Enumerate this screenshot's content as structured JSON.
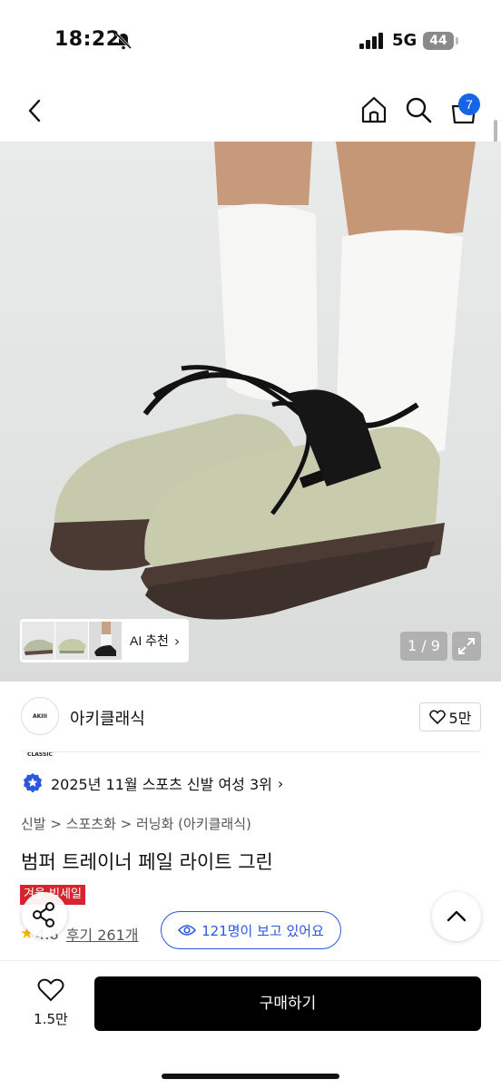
{
  "status_bar": {
    "time": "18:22",
    "network": "5G",
    "battery": "44"
  },
  "nav": {
    "cart_count": "7"
  },
  "gallery": {
    "ai_recommend_label": "AI 추천",
    "counter": "1 / 9"
  },
  "brand": {
    "logo_text": "AKIII CLASSIC",
    "name": "아키클래식",
    "likes": "5만"
  },
  "product": {
    "rank_text": "2025년 11월 스포츠 신발 여성 3위",
    "breadcrumb": "신발 > 스포츠화 > 러닝화 (아키클래식)",
    "title": "범퍼 트레이너 페일 라이트 그린",
    "sale_badge": "겨울 빅세일",
    "rating": "4.8",
    "reviews": "후기 261개",
    "viewers": "121명이 보고 있어요"
  },
  "bottom_bar": {
    "wish_count": "1.5만",
    "buy_label": "구매하기"
  },
  "colors": {
    "accent_blue": "#2a56e0",
    "badge_blue": "#1565e6",
    "sale_red": "#d9232e",
    "buy_button": "#000000"
  }
}
